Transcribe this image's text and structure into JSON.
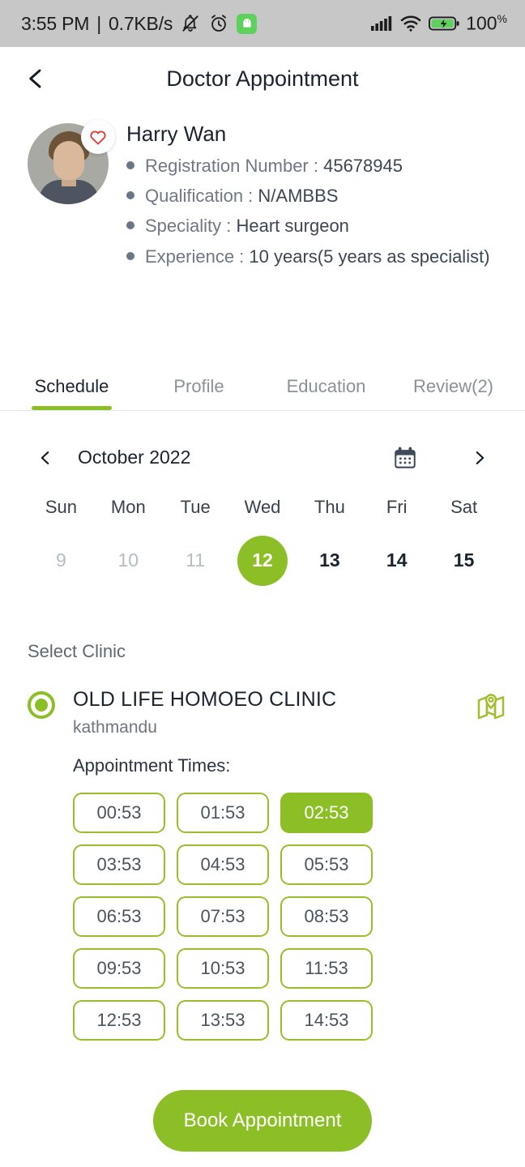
{
  "status_bar": {
    "time": "3:55 PM",
    "separator": "|",
    "network_speed": "0.7KB/s",
    "icons": [
      "mute-bell-icon",
      "alarm-clock-icon",
      "android-app-icon",
      "cellular-signal-icon",
      "wifi-icon",
      "battery-charging-icon"
    ],
    "battery_level": "100",
    "battery_unit": "%"
  },
  "header": {
    "title": "Doctor Appointment",
    "back_icon": "chevron-left-icon"
  },
  "doctor": {
    "name": "Harry Wan",
    "favorite_icon": "heart-icon",
    "details": [
      {
        "label": "Registration Number : ",
        "value": "45678945"
      },
      {
        "label": "Qualification : ",
        "value": "N/AMBBS"
      },
      {
        "label": "Speciality : ",
        "value": "Heart surgeon"
      },
      {
        "label": "Experience : ",
        "value": "10 years(5 years as specialist)"
      }
    ]
  },
  "tabs": [
    {
      "label": "Schedule",
      "active": true
    },
    {
      "label": "Profile",
      "active": false
    },
    {
      "label": "Education",
      "active": false
    },
    {
      "label": "Review(2)",
      "active": false
    }
  ],
  "calendar": {
    "prev_icon": "chevron-left-icon",
    "next_icon": "chevron-right-icon",
    "picker_icon": "calendar-icon",
    "month_label": "October 2022",
    "weekdays": [
      "Sun",
      "Mon",
      "Tue",
      "Wed",
      "Thu",
      "Fri",
      "Sat"
    ],
    "dates": [
      {
        "day": "9",
        "state": "muted"
      },
      {
        "day": "10",
        "state": "muted"
      },
      {
        "day": "11",
        "state": "muted"
      },
      {
        "day": "12",
        "state": "selected"
      },
      {
        "day": "13",
        "state": "normal"
      },
      {
        "day": "14",
        "state": "normal"
      },
      {
        "day": "15",
        "state": "normal"
      }
    ]
  },
  "clinic_section": {
    "heading": "Select Clinic",
    "map_icon": "map-location-icon",
    "radio_icon": "radio-selected-icon",
    "clinic": {
      "name": "OLD LIFE HOMOEO CLINIC",
      "address": "kathmandu",
      "times_label": "Appointment Times:",
      "selected_time": "02:53",
      "times": [
        "00:53",
        "01:53",
        "02:53",
        "03:53",
        "04:53",
        "05:53",
        "06:53",
        "07:53",
        "08:53",
        "09:53",
        "10:53",
        "11:53",
        "12:53",
        "13:53",
        "14:53"
      ]
    }
  },
  "footer": {
    "book_label": "Book Appointment"
  },
  "colors": {
    "accent_green": "#8CBF26",
    "slot_border": "#97BF2B",
    "heart_red": "#E23A3A",
    "status_bar_bg": "#C7C7C7",
    "text_dark": "#1B2330",
    "text_muted": "#8B9199"
  }
}
